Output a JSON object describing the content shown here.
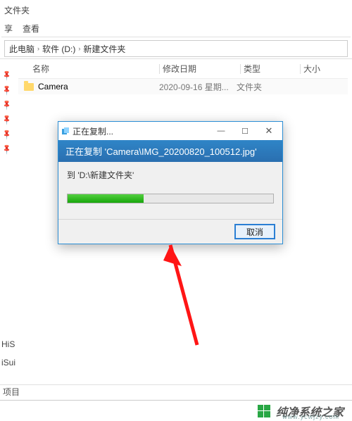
{
  "topbar": {
    "tab_label": "文件夹",
    "share_label": "享",
    "view_label": "查看"
  },
  "breadcrumb": {
    "root": "此电脑",
    "drive": "软件 (D:)",
    "folder": "新建文件夹"
  },
  "columns": {
    "name": "名称",
    "date": "修改日期",
    "type": "类型",
    "size": "大小"
  },
  "rows": [
    {
      "name": "Camera",
      "date": "2020-09-16 星期...",
      "type": "文件夹"
    }
  ],
  "dialog": {
    "title": "正在复制...",
    "banner": "正在复制 'Camera\\IMG_20200820_100512.jpg'",
    "dest": "到 'D:\\新建文件夹'",
    "progress_percent": 37,
    "cancel": "取消",
    "minimize": "—",
    "maximize": "☐",
    "close": "✕"
  },
  "side": {
    "item1": "HiS",
    "item2": "iSui"
  },
  "status": {
    "label": "项目"
  },
  "footer": {
    "brand": "纯净系统之家",
    "url": "www.ycwjzy.com"
  }
}
